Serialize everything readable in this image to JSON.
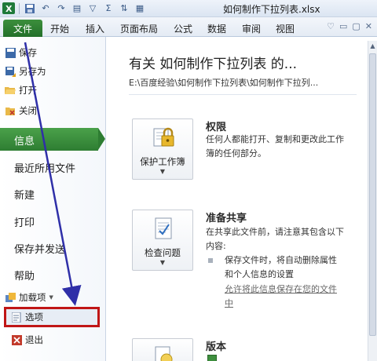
{
  "window": {
    "title": "如何制作下拉列表.xlsx"
  },
  "qat": {
    "icons": [
      "excel-icon",
      "save-icon",
      "undo-icon",
      "redo-icon",
      "format-icon",
      "filter-icon",
      "autosum-icon",
      "sort-icon",
      "borders-icon"
    ]
  },
  "ribbon": {
    "file_tab": "文件",
    "tabs": [
      "开始",
      "插入",
      "页面布局",
      "公式",
      "数据",
      "审阅",
      "视图"
    ]
  },
  "backstage": {
    "commands": [
      {
        "label": "保存",
        "icon": "save-icon"
      },
      {
        "label": "另存为",
        "icon": "save-as-icon"
      },
      {
        "label": "打开",
        "icon": "open-folder-icon"
      },
      {
        "label": "关闭",
        "icon": "close-file-icon"
      }
    ],
    "nav": {
      "info": "信息",
      "recent": "最近所用文件",
      "new": "新建",
      "print": "打印",
      "save_send": "保存并发送",
      "help": "帮助",
      "addins": "加载项",
      "options": "选项",
      "exit": "退出"
    }
  },
  "info": {
    "title": "有关 如何制作下拉列表 的...",
    "path": "E:\\百度经验\\如何制作下拉列表\\如何制作下拉列...",
    "sections": [
      {
        "button": "保护工作簿",
        "heading": "权限",
        "text": "任何人都能打开、复制和更改此工作簿的任何部分。"
      },
      {
        "button": "检查问题",
        "heading": "准备共享",
        "text": "在共享此文件前，请注意其包含以下内容:",
        "bullet": "保存文件时，将自动删除属性和个人信息的设置",
        "link": "允许将此信息保存在您的文件中"
      },
      {
        "heading": "版本"
      }
    ]
  },
  "colors": {
    "file_green": "#2e7d32",
    "highlight_red": "#c01616",
    "arrow_blue": "#2f2fa8"
  }
}
